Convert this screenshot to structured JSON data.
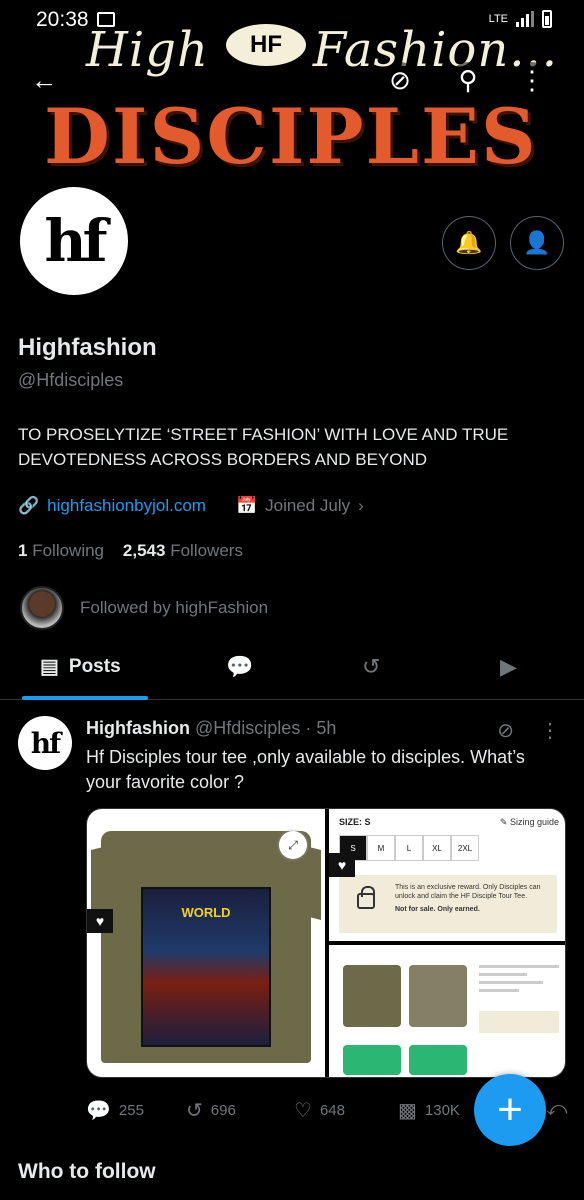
{
  "status": {
    "time": "20:38",
    "network": "LTE"
  },
  "banner": {
    "top_text": "High",
    "logo_text": "HF",
    "top_text_right": "Fashion...",
    "main_text": "DISCIPLES"
  },
  "profile": {
    "avatar_text": "hf",
    "name": "Highfashion",
    "handle": "@Hfdisciples",
    "bio": "TO PROSELYTIZE ‘STREET FASHION’ WITH LOVE AND TRUE DEVOTEDNESS ACROSS BORDERS AND BEYOND",
    "website": "highfashionbyjol.com",
    "joined": "Joined July",
    "following_count": "1",
    "following_label": "Following",
    "followers_count": "2,543",
    "followers_label": "Followers",
    "followed_by": "Followed by highFashion"
  },
  "tabs": {
    "posts": "Posts"
  },
  "post": {
    "avatar_text": "hf",
    "author": "Highfashion",
    "handle": "@Hfdisciples",
    "separator": "·",
    "time": "5h",
    "text": "Hf Disciples tour tee ,only available to disciples. What’s your favorite color ?",
    "media": {
      "shirt_print": "WORLD",
      "size_label": "SIZE: S",
      "sizing_guide": "Sizing guide",
      "sizes": [
        "S",
        "M",
        "L",
        "XL",
        "2XL"
      ],
      "reward_text": "This is an exclusive reward. Only Disciples can unlock and claim the HF Disciple Tour Tee.",
      "reward_bold": "Not for sale. Only earned."
    },
    "replies": "255",
    "reposts": "696",
    "likes": "648",
    "views": "130K"
  },
  "who_to_follow": "Who to follow",
  "colors": {
    "accent": "#1d9bf0",
    "banner_orange": "#e35a2c",
    "muted": "#71767b"
  }
}
